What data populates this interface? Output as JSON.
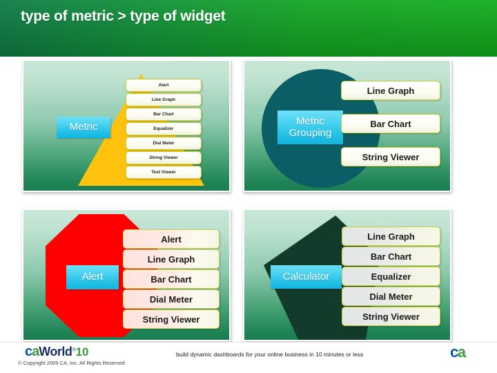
{
  "header": {
    "title": "type of metric > type of widget",
    "gradient_from": "#0e7a45",
    "gradient_to": "#12ad1c"
  },
  "panels": [
    {
      "id": "panel-tl",
      "name": "metric-panel",
      "shape": "triangle",
      "shape_color": "#FFC20E",
      "category_label": "Metric",
      "category_color": "#22bfe6",
      "chip_size": "small",
      "widgets": [
        "Alert",
        "Line Graph",
        "Bar Chart",
        "Equalizer",
        "Dial Meter",
        "String Viewer",
        "Text Viewer"
      ]
    },
    {
      "id": "panel-tr",
      "name": "metric-grouping-panel",
      "shape": "circle",
      "shape_color": "#0C5E66",
      "category_label": "Metric Grouping",
      "category_line1": "Metric",
      "category_line2": "Grouping",
      "category_color": "#22bfe6",
      "chip_size": "large",
      "widgets": [
        "Line Graph",
        "Bar Chart",
        "String Viewer"
      ]
    },
    {
      "id": "panel-bl",
      "name": "alert-panel",
      "shape": "octagon",
      "shape_color": "#FF0000",
      "category_label": "Alert",
      "category_color": "#22bfe6",
      "chip_size": "large",
      "chip_style": "pink",
      "widgets": [
        "Alert",
        "Line Graph",
        "Bar Chart",
        "Dial Meter",
        "String Viewer"
      ]
    },
    {
      "id": "panel-br",
      "name": "calculator-panel",
      "shape": "pentagon",
      "shape_color": "#123B2B",
      "category_label": "Calculator",
      "category_color": "#22bfe6",
      "chip_size": "large",
      "chip_style": "grey",
      "widgets": [
        "Line Graph",
        "Bar Chart",
        "Equalizer",
        "Dial Meter",
        "String Viewer"
      ]
    }
  ],
  "footer": {
    "logo_ca_c": "c",
    "logo_ca_a": "a",
    "logo_world": "World",
    "logo_tm": "®",
    "logo_ten": "10",
    "copyright": "© Copyright 2009 CA, Inc. All Rights Reserved",
    "tagline": "build dynamic dashboards for your online business in 10 minutes or less",
    "mark_c": "c",
    "mark_a": "a",
    "mark_dot": "."
  }
}
